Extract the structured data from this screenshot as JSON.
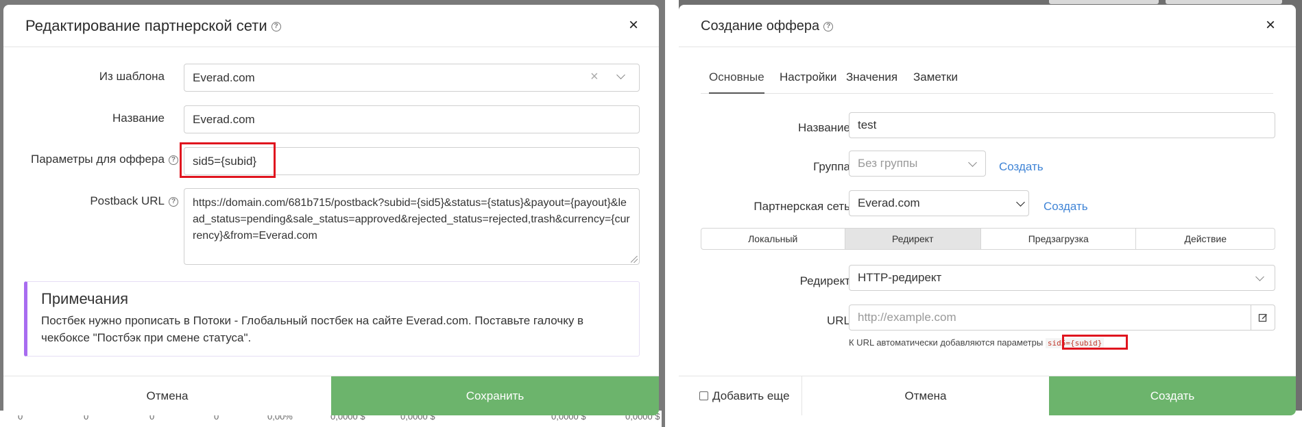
{
  "left_modal": {
    "title": "Редактирование партнерской сети",
    "close": "×",
    "fields": {
      "template_label": "Из шаблона",
      "template_value": "Everad.com",
      "name_label": "Название",
      "name_value": "Everad.com",
      "params_label": "Параметры для оффера",
      "params_value": "sid5={subid}",
      "postback_label": "Postback URL",
      "postback_value": "https://domain.com/681b715/postback?subid={sid5}&status={status}&payout={payout}&lead_status=pending&sale_status=approved&rejected_status=rejected,trash&currency={currency}&from=Everad.com"
    },
    "notes": {
      "title": "Примечания",
      "text": "Постбек нужно прописать в Потоки - Глобальный постбек на сайте Everad.com. Поставьте галочку в чекбоксе \"Постбэк при смене статуса\"."
    },
    "footer": {
      "cancel": "Отмена",
      "save": "Сохранить"
    }
  },
  "right_modal": {
    "title": "Создание оффера",
    "close": "×",
    "tabs": [
      "Основные",
      "Настройки",
      "Значения",
      "Заметки"
    ],
    "fields": {
      "name_label": "Название",
      "name_value": "test",
      "group_label": "Группа",
      "group_value": "Без группы",
      "group_create": "Создать",
      "network_label": "Партнерская сеть",
      "network_value": "Everad.com",
      "network_create": "Создать",
      "redirect_label": "Редирект",
      "redirect_value": "HTTP-редирект",
      "url_label": "URL",
      "url_placeholder": "http://example.com",
      "url_hint": "К URL автоматически добавляются параметры",
      "url_hint_code": "sid5={subid}"
    },
    "segments": [
      "Локальный",
      "Редирект",
      "Предзагрузка",
      "Действие"
    ],
    "active_segment": "Редирект",
    "footer": {
      "add_more": "Добавить еще",
      "cancel": "Отмена",
      "create": "Создать"
    }
  },
  "background": {
    "row_values": [
      "0",
      "0",
      "0",
      "0",
      "0,00%",
      "0,0000 $",
      "0,0000 $",
      "0,0000 $",
      "0,0000 $"
    ]
  },
  "colors": {
    "primary_button": "#6cb46c",
    "link": "#3f84d6",
    "highlight": "#e0141e",
    "notes_accent": "#a86cf0"
  }
}
